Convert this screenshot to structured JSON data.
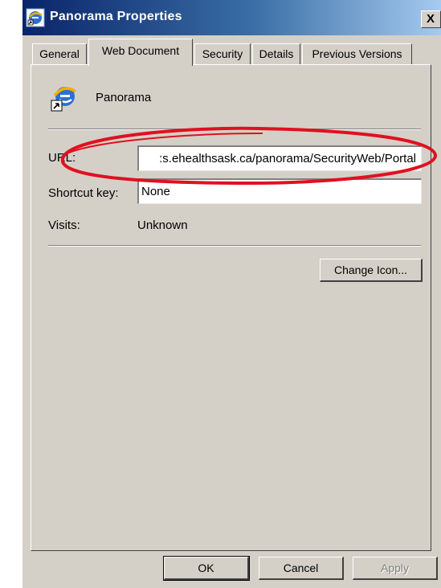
{
  "window": {
    "title": "Panorama Properties",
    "close_glyph": "X"
  },
  "tabs": [
    {
      "label": "General",
      "active": false
    },
    {
      "label": "Web Document",
      "active": true
    },
    {
      "label": "Security",
      "active": false
    },
    {
      "label": "Details",
      "active": false
    },
    {
      "label": "Previous Versions",
      "active": false
    }
  ],
  "document": {
    "name": "Panorama",
    "icon": "internet-explorer-shortcut-icon"
  },
  "fields": {
    "url_label": "URL:",
    "url_value": ":s.ehealthsask.ca/panorama/SecurityWeb/Portal",
    "shortcut_label": "Shortcut key:",
    "shortcut_value": "None",
    "visits_label": "Visits:",
    "visits_value": "Unknown"
  },
  "buttons": {
    "change_icon": "Change Icon...",
    "ok": "OK",
    "cancel": "Cancel",
    "apply": "Apply"
  },
  "colors": {
    "titlebar_start": "#0a246a",
    "titlebar_end": "#a6caf0",
    "annotation": "#e01020",
    "dialog_face": "#d4d0c8"
  }
}
